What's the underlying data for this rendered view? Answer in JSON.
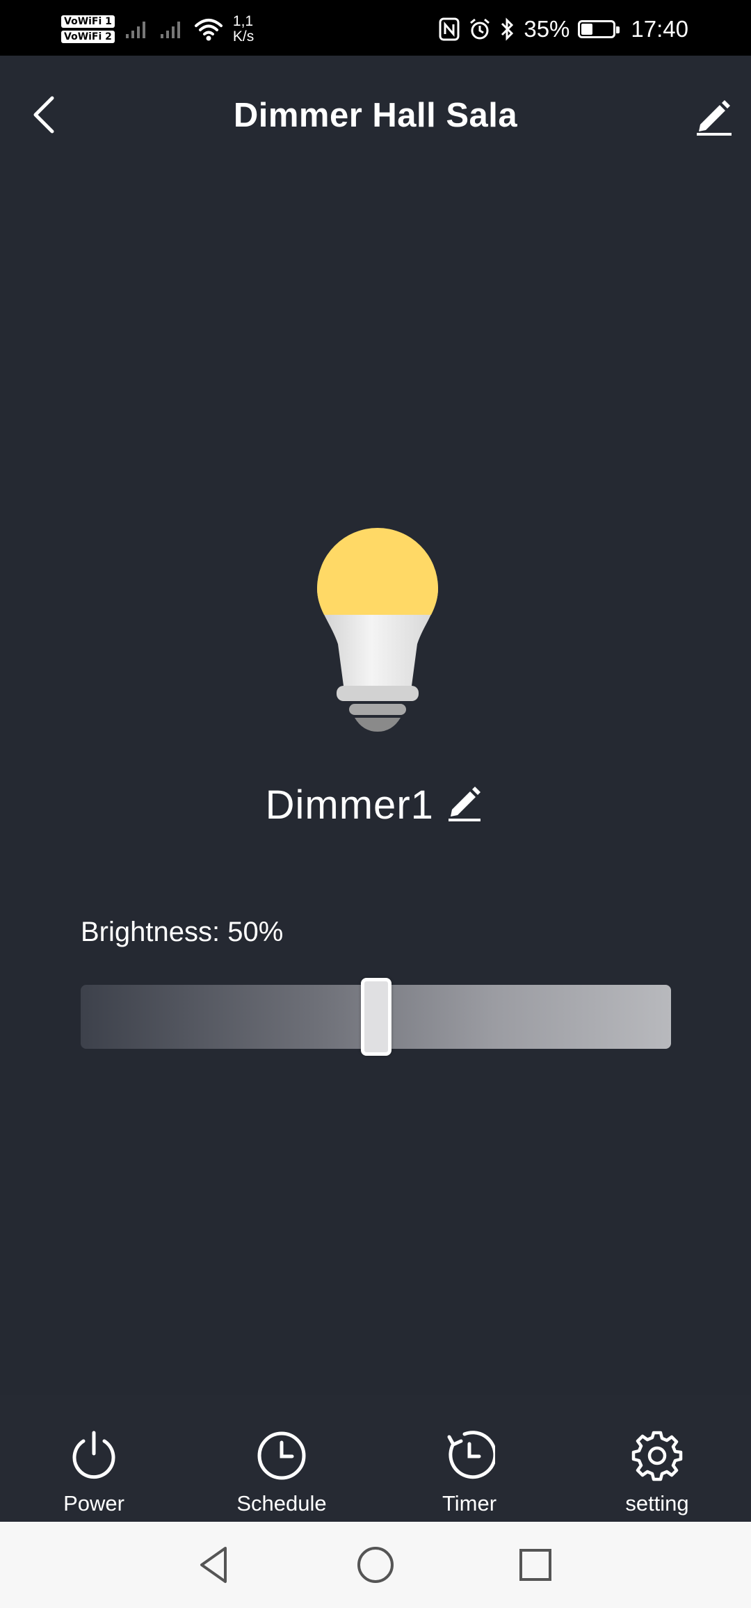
{
  "status_bar": {
    "vowifi_1": "VoWiFi 1",
    "vowifi_2": "VoWiFi 2",
    "net_speed_value": "1,1",
    "net_speed_unit": "K/s",
    "battery_percent": "35%",
    "battery_level": 0.35,
    "time": "17:40"
  },
  "header": {
    "title": "Dimmer Hall Sala"
  },
  "device": {
    "name": "Dimmer1"
  },
  "brightness": {
    "label": "Brightness: 50%",
    "value_percent": 50
  },
  "tabs": [
    {
      "label": "Power",
      "icon": "power-icon"
    },
    {
      "label": "Schedule",
      "icon": "clock-icon"
    },
    {
      "label": "Timer",
      "icon": "timer-icon"
    },
    {
      "label": "setting",
      "icon": "gear-icon"
    }
  ],
  "nav": {
    "back_icon": "triangle-back-icon",
    "home_icon": "circle-home-icon",
    "recents_icon": "square-recents-icon"
  },
  "colors": {
    "background": "#252932",
    "bulb_glow": "#FFD966",
    "text": "#FFFFFF"
  }
}
